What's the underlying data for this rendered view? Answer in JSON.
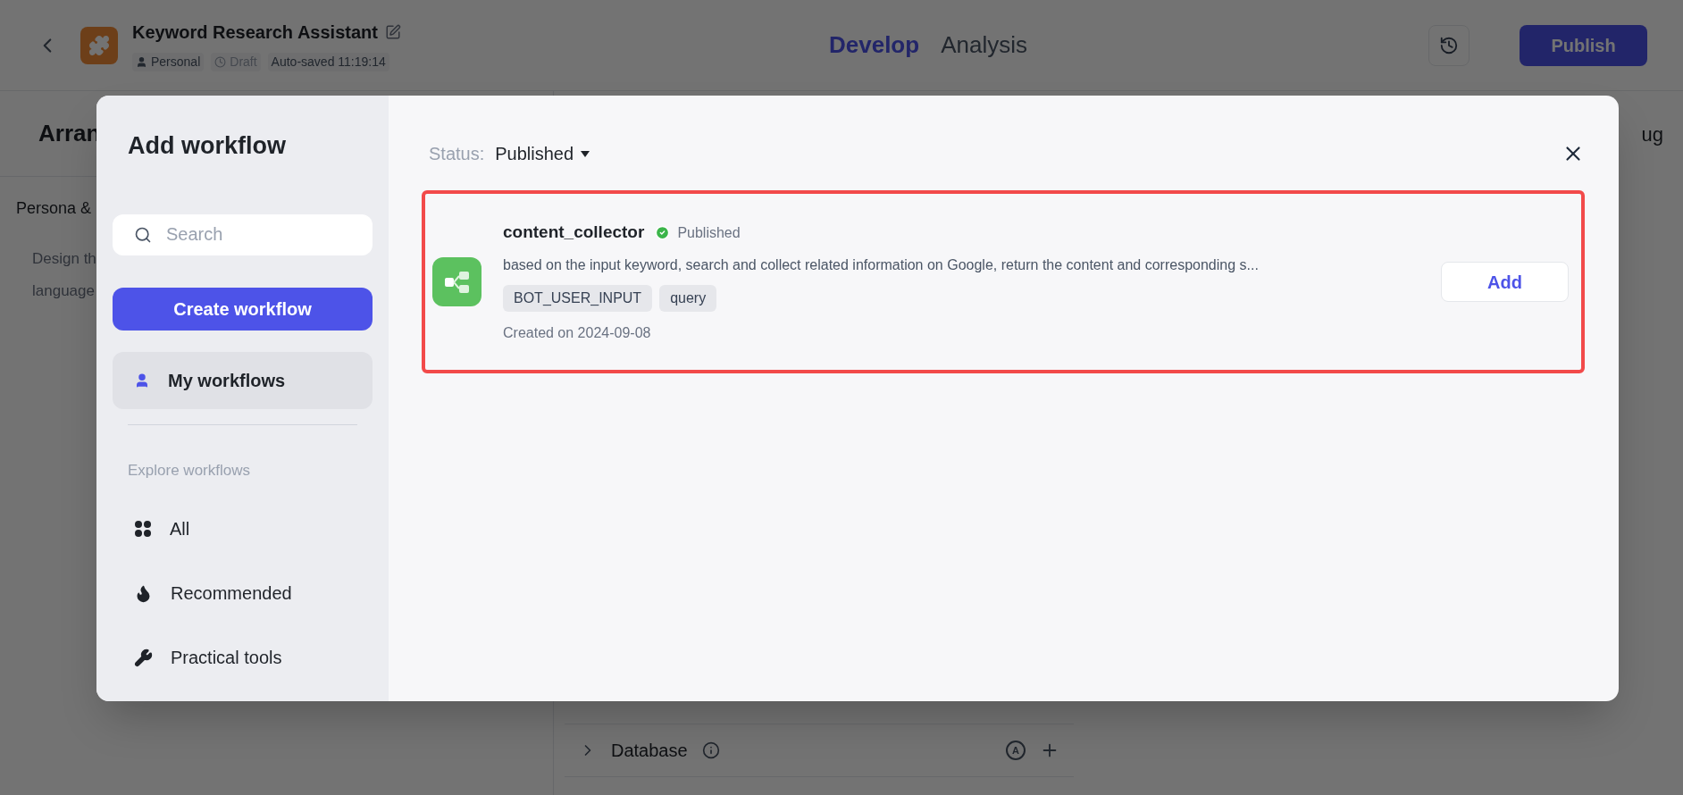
{
  "header": {
    "title": "Keyword Research Assistant",
    "owner": "Personal",
    "state": "Draft",
    "autosave": "Auto-saved 11:19:14",
    "tabs": [
      {
        "label": "Develop",
        "selected": true
      },
      {
        "label": "Analysis",
        "selected": false
      }
    ],
    "publish": "Publish"
  },
  "background": {
    "heading": "Arran",
    "section": "Persona &",
    "text_lines": [
      "Design th",
      "language"
    ],
    "right_heading": "ug",
    "panel_rows": [
      {
        "label": "Database",
        "badge": "A"
      }
    ]
  },
  "modal": {
    "sidebar": {
      "title": "Add workflow",
      "search": {
        "placeholder": "Search"
      },
      "create_button": "Create workflow",
      "my_workflows": {
        "label": "My workflows",
        "selected": true
      },
      "section_label": "Explore workflows",
      "categories": [
        {
          "label": "All",
          "selected": false
        },
        {
          "label": "Recommended",
          "selected": false
        },
        {
          "label": "Practical tools",
          "selected": false
        }
      ]
    },
    "status": {
      "label": "Status:",
      "value": "Published"
    },
    "workflows": [
      {
        "name": "content_collector",
        "status": "Published",
        "published": true,
        "description": "based on the input keyword, search and collect related information on Google, return the content and corresponding s...",
        "tags": [
          "BOT_USER_INPUT",
          "query"
        ],
        "created": "Created on 2024-09-08",
        "action": "Add",
        "highlighted": true
      }
    ]
  }
}
